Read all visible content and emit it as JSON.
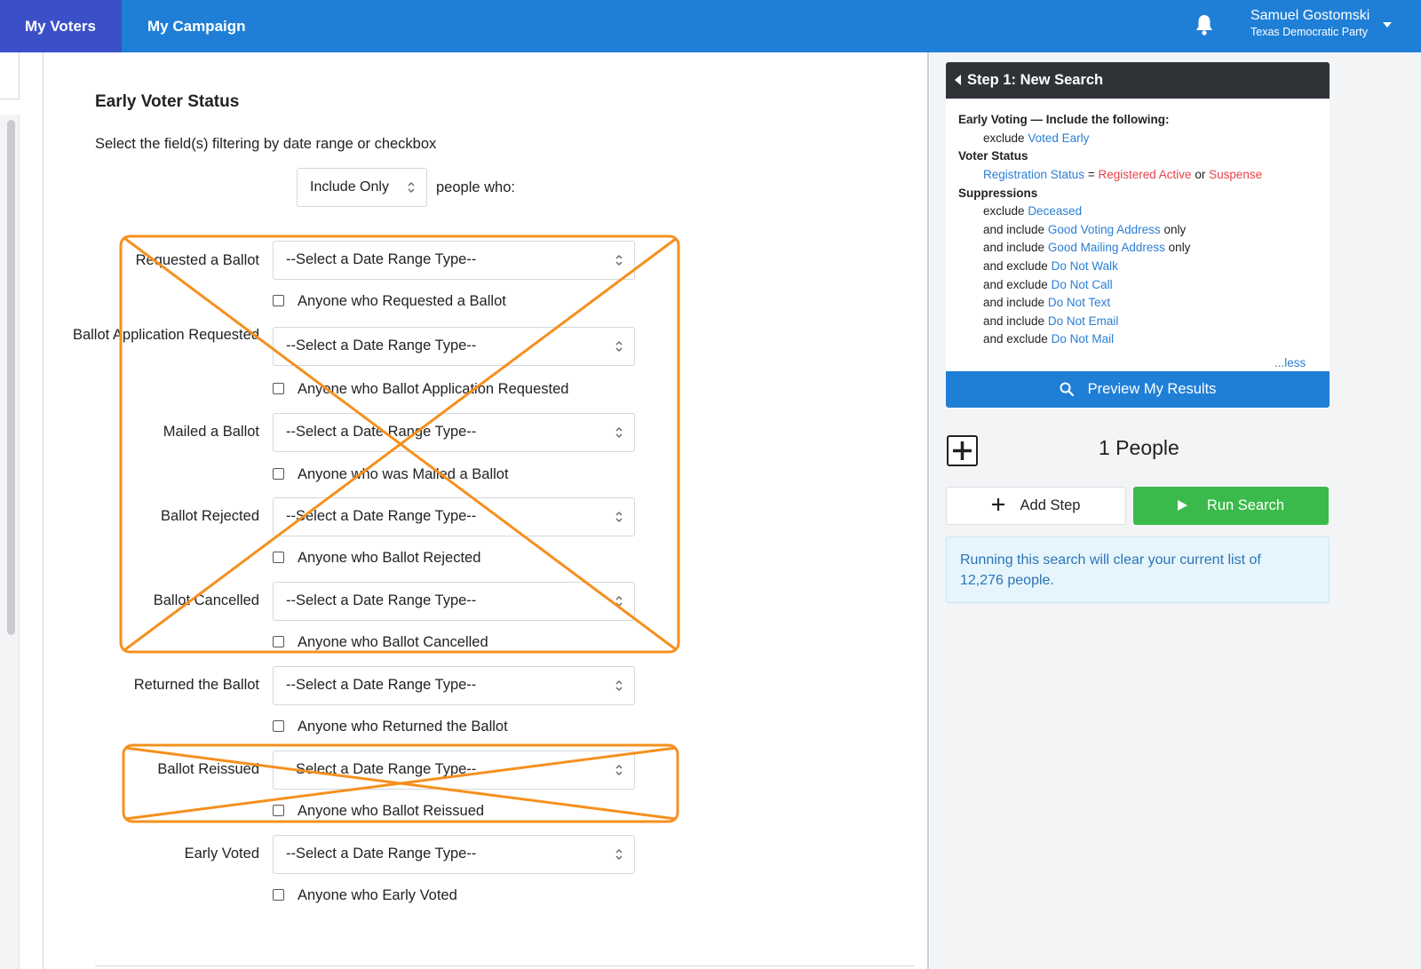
{
  "topnav": {
    "tabs": [
      {
        "label": "My Voters",
        "active": true
      },
      {
        "label": "My Campaign",
        "active": false
      }
    ],
    "user_name": "Samuel Gostomski",
    "user_party": "Texas Democratic Party",
    "icons": [
      "bell-icon",
      "caret-down-icon"
    ],
    "bar_color": "#1f7fd6",
    "active_tab_color": "#3b50c8"
  },
  "form": {
    "title": "Early Voter Status",
    "subtitle": "Select the field(s) filtering by date range or checkbox",
    "include_select_value": "Include Only",
    "people_who": "people who:",
    "fields": [
      {
        "label": "Requested a Ballot",
        "select": "--Select a Date Range Type--",
        "checkbox": "Anyone who Requested a Ballot"
      },
      {
        "label": "Ballot Application Requested",
        "select": "--Select a Date Range Type--",
        "checkbox": "Anyone who Ballot Application Requested"
      },
      {
        "label": "Mailed a Ballot",
        "select": "--Select a Date Range Type--",
        "checkbox": "Anyone who was Mailed a Ballot"
      },
      {
        "label": "Ballot Rejected",
        "select": "--Select a Date Range Type--",
        "checkbox": "Anyone who Ballot Rejected"
      },
      {
        "label": "Ballot Cancelled",
        "select": "--Select a Date Range Type--",
        "checkbox": "Anyone who Ballot Cancelled"
      },
      {
        "label": "Returned the Ballot",
        "select": "--Select a Date Range Type--",
        "checkbox": "Anyone who Returned the Ballot"
      },
      {
        "label": "Ballot Reissued",
        "select": "--Select a Date Range Type--",
        "checkbox": "Anyone who Ballot Reissued"
      },
      {
        "label": "Early Voted",
        "select": "--Select a Date Range Type--",
        "checkbox": "Anyone who Early Voted"
      }
    ],
    "annotation_color": "#f5901e"
  },
  "summary": {
    "header": "Step 1: New Search",
    "early_voting_heading": "Early Voting — Include the following:",
    "early_voting_line": {
      "prefix": "exclude",
      "value": "Voted Early"
    },
    "voter_status_heading": "Voter Status",
    "voter_status_line": {
      "field": "Registration Status",
      "eq": "=",
      "value1": "Registered Active",
      "or": "or",
      "value2": "Suspense"
    },
    "suppressions_heading": "Suppressions",
    "suppressions": [
      {
        "prefix": "exclude",
        "value": "Deceased",
        "suffix": ""
      },
      {
        "prefix": "and include",
        "value": "Good Voting Address",
        "suffix": "only"
      },
      {
        "prefix": "and include",
        "value": "Good Mailing Address",
        "suffix": "only"
      },
      {
        "prefix": "and exclude",
        "value": "Do Not Walk",
        "suffix": ""
      },
      {
        "prefix": "and exclude",
        "value": "Do Not Call",
        "suffix": ""
      },
      {
        "prefix": "and include",
        "value": "Do Not Text",
        "suffix": ""
      },
      {
        "prefix": "and include",
        "value": "Do Not Email",
        "suffix": ""
      },
      {
        "prefix": "and exclude",
        "value": "Do Not Mail",
        "suffix": ""
      }
    ],
    "less_link": "...less",
    "preview_button": "Preview My Results",
    "people_count": "1 People",
    "add_step_button": "Add Step",
    "run_search_button": "Run Search",
    "notice_line1": "Running this search will clear your current list of",
    "notice_line2": "12,276 people."
  }
}
